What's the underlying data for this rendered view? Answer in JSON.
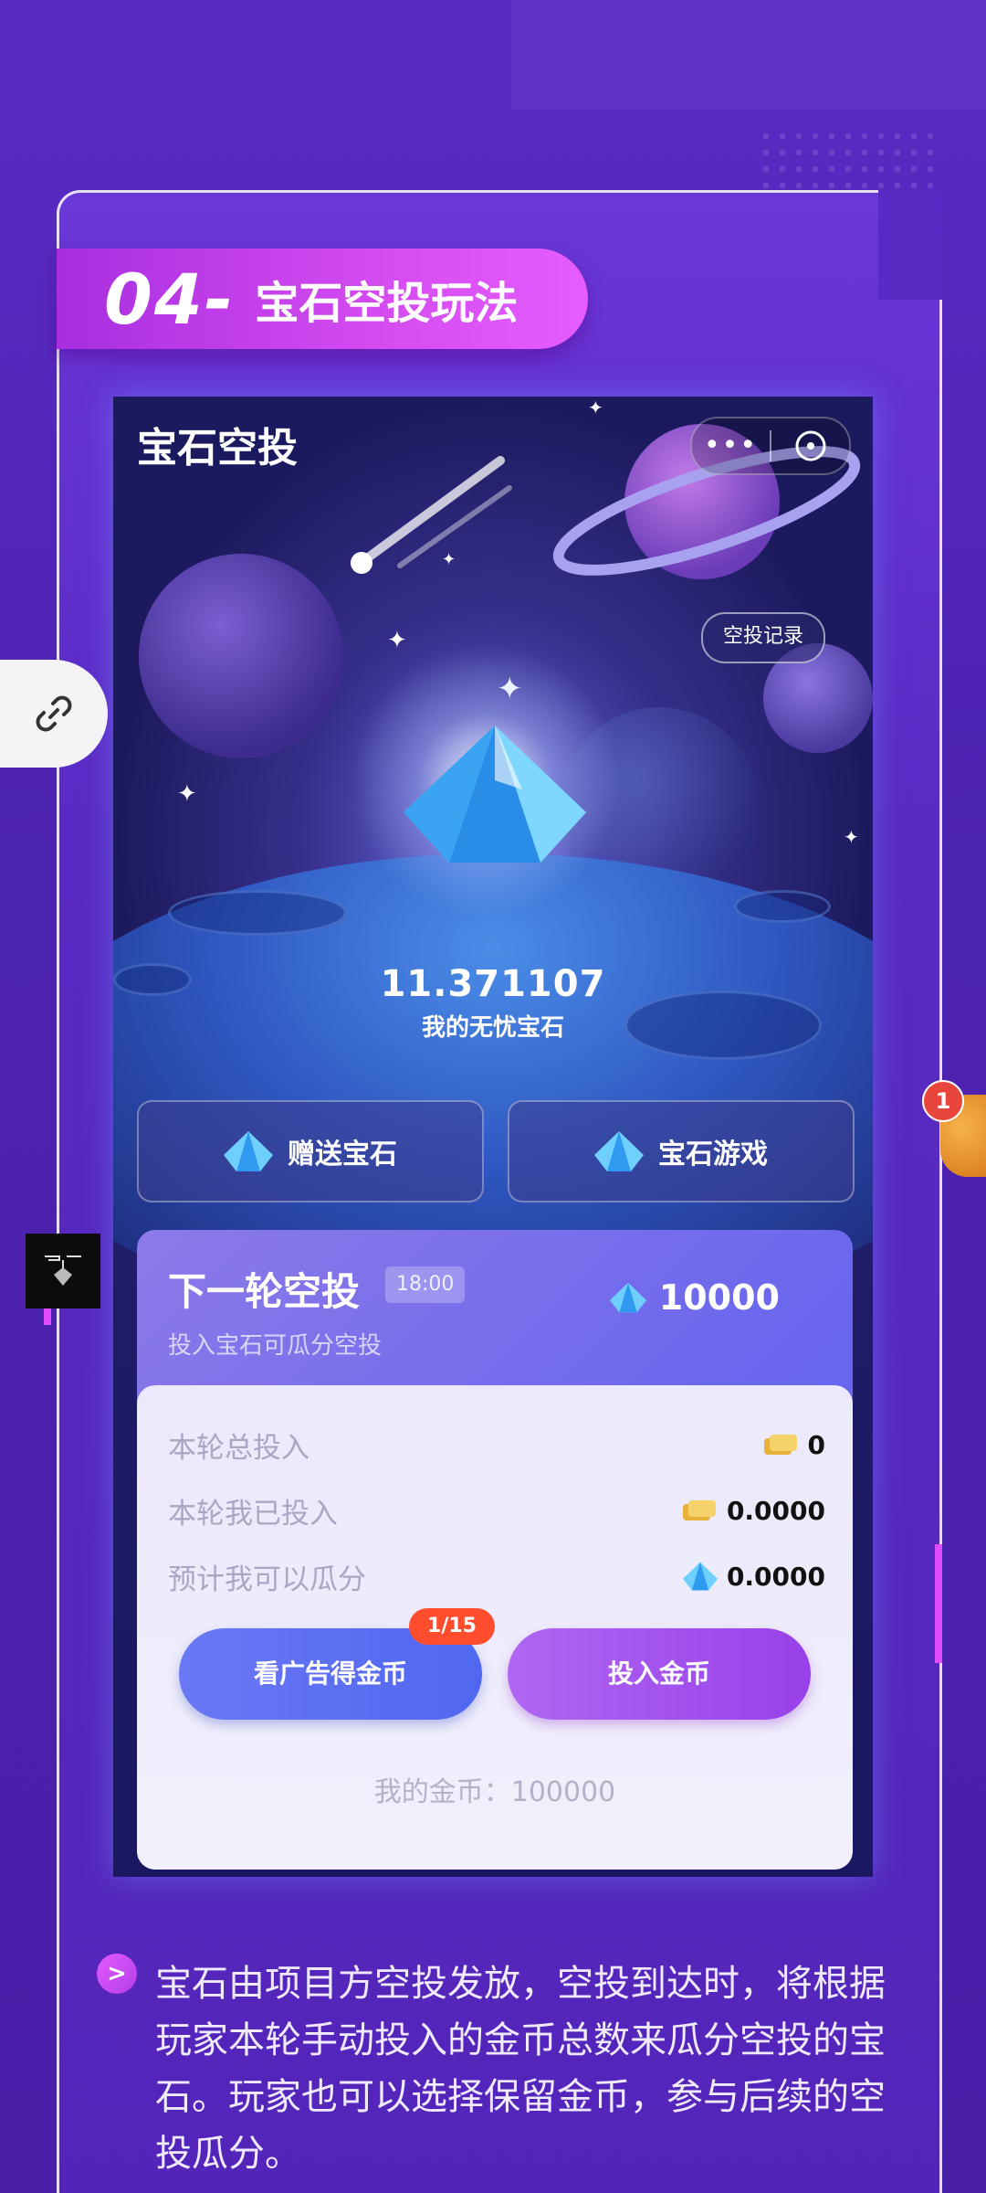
{
  "section": {
    "number": "04-",
    "title": "宝石空投玩法"
  },
  "app": {
    "title": "宝石空投",
    "menu_label": "•••",
    "record_button": "空投记录",
    "gem_balance": "11.371107",
    "gem_balance_label": "我的无忧宝石"
  },
  "actions": {
    "gift_gems": "赠送宝石",
    "gem_game": "宝石游戏"
  },
  "round": {
    "title": "下一轮空投",
    "time": "18:00",
    "subtitle": "投入宝石可瓜分空投",
    "pool_amount": "10000",
    "stats": [
      {
        "label": "本轮总投入",
        "value": "0",
        "icon": "gold-coin-icon"
      },
      {
        "label": "本轮我已投入",
        "value": "0.0000",
        "icon": "gold-coin-icon"
      },
      {
        "label": "预计我可以瓜分",
        "value": "0.0000",
        "icon": "gem-icon"
      }
    ],
    "ad_button": "看广告得金币",
    "ad_badge": "1/15",
    "invest_button": "投入金币",
    "my_coins": "我的金币：100000"
  },
  "description": {
    "bullet": ">",
    "text": "宝石由项目方空投发放，空投到达时，将根据玩家本轮手动投入的金币总数来瓜分空投的宝石。玩家也可以选择保留金币，参与后续的空投瓜分。"
  },
  "notification": {
    "count": "1"
  },
  "colors": {
    "background": "#5a2bc4",
    "accent_pink": "#d44bf0",
    "card_blue": "#6b67ee",
    "invest_purple": "#9840ea",
    "badge_red": "#ff4d2d"
  }
}
